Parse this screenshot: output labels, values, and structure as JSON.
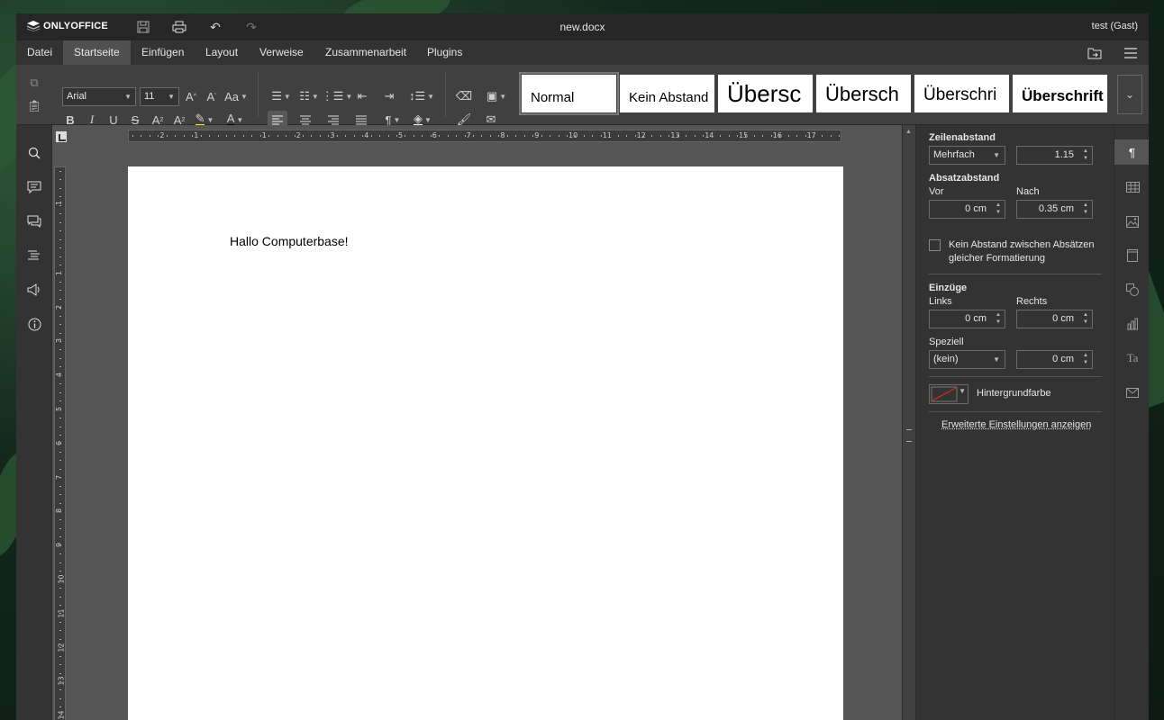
{
  "app": {
    "logo": "ONLYOFFICE",
    "document_title": "new.docx",
    "user": "test (Gast)"
  },
  "menu": {
    "tabs": [
      "Datei",
      "Startseite",
      "Einfügen",
      "Layout",
      "Verweise",
      "Zusammenarbeit",
      "Plugins"
    ],
    "active_tab": "Startseite"
  },
  "toolbar": {
    "font_name": "Arial",
    "font_size": "11",
    "styles": [
      "Normal",
      "Kein Abstand",
      "Übersc",
      "Übersch",
      "Überschri",
      "Überschrift"
    ]
  },
  "ruler": {
    "horizontal_labels": [
      "2",
      "1",
      "1",
      "2",
      "3",
      "4",
      "5",
      "6",
      "7",
      "8",
      "9",
      "10",
      "11",
      "12",
      "13",
      "14",
      "15",
      "16",
      "17"
    ],
    "vertical_labels": [
      "1",
      "1",
      "2",
      "3",
      "4",
      "5",
      "6",
      "7",
      "8",
      "9",
      "10",
      "11",
      "12",
      "13",
      "14"
    ]
  },
  "document": {
    "text": "Hallo Computerbase!"
  },
  "paragraph_settings": {
    "line_spacing_title": "Zeilenabstand",
    "line_spacing_mode": "Mehrfach",
    "line_spacing_value": "1.15",
    "paragraph_spacing_title": "Absatzabstand",
    "before_label": "Vor",
    "before_value": "0 cm",
    "after_label": "Nach",
    "after_value": "0.35 cm",
    "no_spacing_checkbox": "Kein Abstand zwischen Absätzen",
    "no_spacing_checkbox_2": "gleicher Formatierung",
    "indents_title": "Einzüge",
    "left_label": "Links",
    "left_value": "0 cm",
    "right_label": "Rechts",
    "right_value": "0 cm",
    "special_label": "Speziell",
    "special_value": "(kein)",
    "special_amount": "0 cm",
    "background_color_label": "Hintergrundfarbe",
    "advanced_link": "Erweiterte Einstellungen anzeigen"
  }
}
